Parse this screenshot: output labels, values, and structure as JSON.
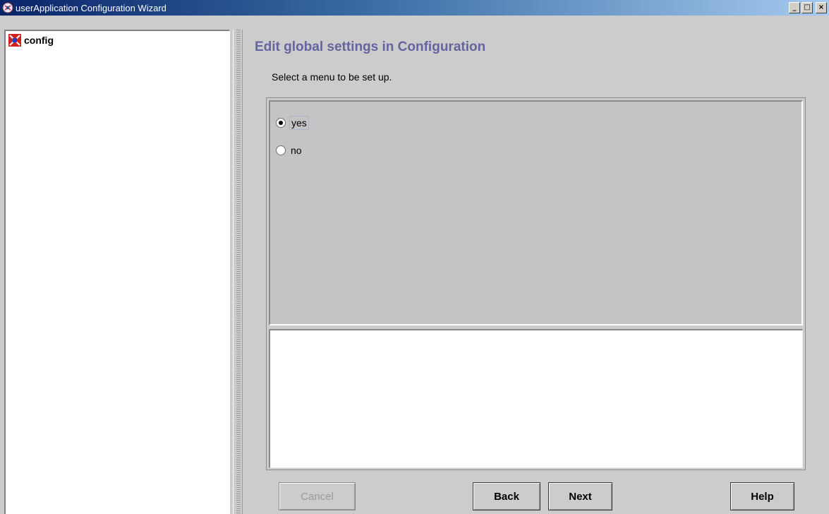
{
  "window": {
    "title": "userApplication Configuration Wizard",
    "controls": {
      "minimize": "_",
      "maximize": "□",
      "close": "×"
    }
  },
  "tree": {
    "root_label": "config",
    "root_icon": "config-node-icon"
  },
  "main": {
    "title": "Edit global settings in Configuration",
    "instruction": "Select a menu to be set up.",
    "options": [
      {
        "label": "yes",
        "selected": true
      },
      {
        "label": "no",
        "selected": false
      }
    ],
    "description": ""
  },
  "buttons": {
    "cancel": "Cancel",
    "back": "Back",
    "next": "Next",
    "help": "Help"
  },
  "colors": {
    "title_accent": "#6464a0",
    "titlebar_start": "#0a246a",
    "titlebar_end": "#a6caf0"
  }
}
